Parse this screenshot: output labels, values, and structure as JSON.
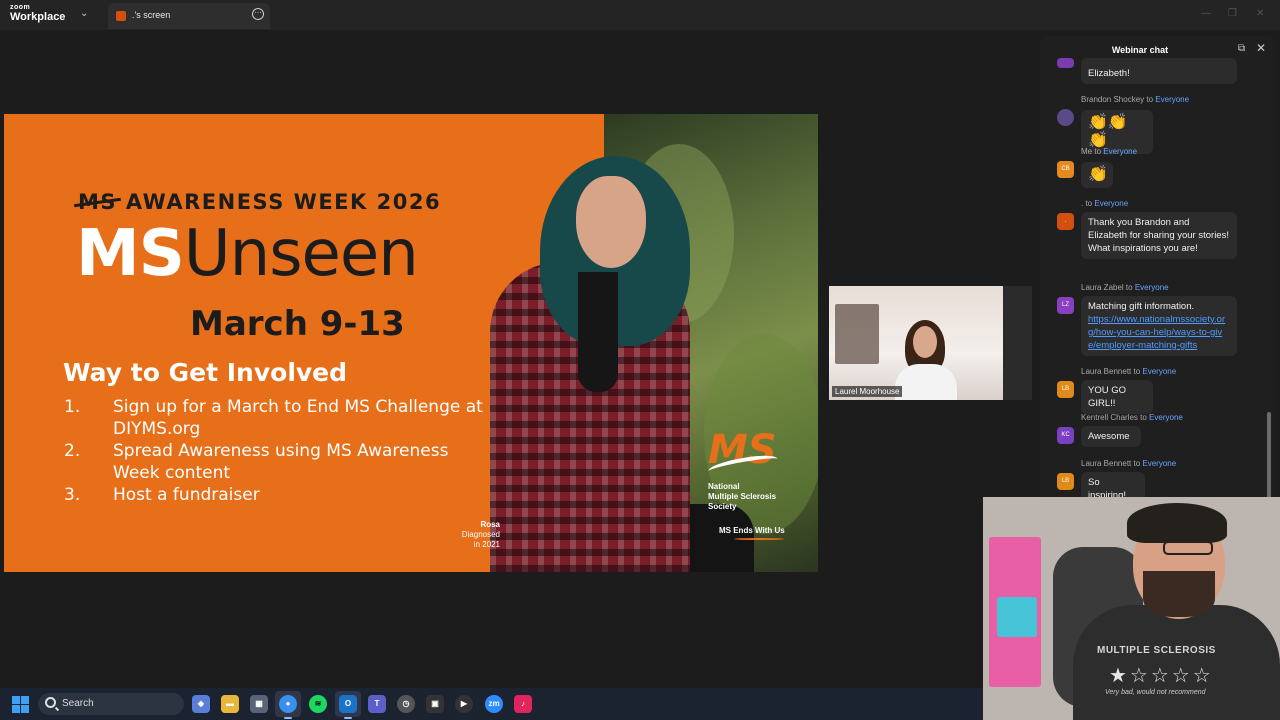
{
  "titlebar": {
    "brand_small": "zoom",
    "brand_big": "Workplace",
    "tab_title": ".'s screen",
    "caret": "⌄",
    "more_glyph": "⋯",
    "minimize": "—",
    "restore": "❐",
    "close": "✕"
  },
  "slide": {
    "awareness_prefix": "MS",
    "awareness_rest": " AWARENESS WEEK 2026",
    "title_ms": "MS",
    "title_rest": "Unseen",
    "dates": "March 9-13",
    "involved_heading": "Way to Get Involved",
    "steps": [
      {
        "num": "1.",
        "text": "Sign up for a March to End MS Challenge at DIYMS.org"
      },
      {
        "num": "2.",
        "text": "Spread Awareness using MS Awareness Week content"
      },
      {
        "num": "3.",
        "text": "Host a fundraiser"
      }
    ],
    "caption_name": "Rosa",
    "caption_line1": "Diagnosed",
    "caption_line2": "in 2021",
    "logo_mark": "MS",
    "logo_line1": "National",
    "logo_line2": "Multiple Sclerosis",
    "logo_line3": "Society",
    "tagline": "MS Ends With Us"
  },
  "laurel": {
    "name": "Laurel Moorhouse"
  },
  "chat": {
    "title": "Webinar chat",
    "popout_icon": "⧉",
    "close_icon": "✕",
    "to_word": " to ",
    "messages": [
      {
        "sender": "",
        "recipient": "",
        "avatar": "",
        "avatar_color": "#7a3db0",
        "text": "Elizabeth!"
      },
      {
        "sender": "Brandon Shockey",
        "recipient": "Everyone",
        "avatar": "",
        "avatar_color": "#5a4a8a",
        "text": "👏👏👏"
      },
      {
        "sender": "Me",
        "recipient": "Everyone",
        "avatar": "CB",
        "avatar_color": "#e58a1f",
        "text": "👏"
      },
      {
        "sender": ".",
        "recipient": "Everyone",
        "avatar": ".",
        "avatar_color": "#d4500e",
        "text": "Thank you Brandon and Elizabeth for sharing your stories! What inspirations you are!"
      },
      {
        "sender": "Laura Zabel",
        "recipient": "Everyone",
        "avatar": "LZ",
        "avatar_color": "#8a3fc0",
        "text": "Matching gift information.",
        "link": "https://www.nationalmssociety.org/how-you-can-help/ways-to-give/employer-matching-gifts"
      },
      {
        "sender": "Laura Bennett",
        "recipient": "Everyone",
        "avatar": "LB",
        "avatar_color": "#e08a1a",
        "text": "YOU GO GIRL!!"
      },
      {
        "sender": "Kentrell Charles",
        "recipient": "Everyone",
        "avatar": "KC",
        "avatar_color": "#7b3fc2",
        "text": "Awesome"
      },
      {
        "sender": "Laura Bennett",
        "recipient": "Everyone",
        "avatar": "LB",
        "avatar_color": "#e08a1a",
        "text": "So inspiring!"
      }
    ]
  },
  "selfview": {
    "shirt_text": "MULTIPLE SCLEROSIS",
    "stars": "★☆☆☆☆",
    "review": "Very bad, would not recommend"
  },
  "taskbar": {
    "search_label": "Search",
    "apps": [
      {
        "name": "copilot",
        "glyph": "◆",
        "color": "#5a7dd8"
      },
      {
        "name": "file-explorer",
        "glyph": "▬",
        "color": "#e8b73a"
      },
      {
        "name": "calculator",
        "glyph": "▦",
        "color": "#5a6478"
      },
      {
        "name": "chrome",
        "glyph": "●",
        "color": "#3a8ef0"
      },
      {
        "name": "spotify",
        "glyph": "≋",
        "color": "#1ed760"
      },
      {
        "name": "outlook",
        "glyph": "O",
        "color": "#1a73c8"
      },
      {
        "name": "teams",
        "glyph": "T",
        "color": "#5b5fc7"
      },
      {
        "name": "clock-app",
        "glyph": "◷",
        "color": "#555"
      },
      {
        "name": "capture-app",
        "glyph": "▣",
        "color": "#333"
      },
      {
        "name": "media-player",
        "glyph": "▶",
        "color": "#333"
      },
      {
        "name": "zoom-app",
        "glyph": "zm",
        "color": "#2d8cff"
      },
      {
        "name": "tiktok",
        "glyph": "♪",
        "color": "#e0245e"
      }
    ]
  }
}
